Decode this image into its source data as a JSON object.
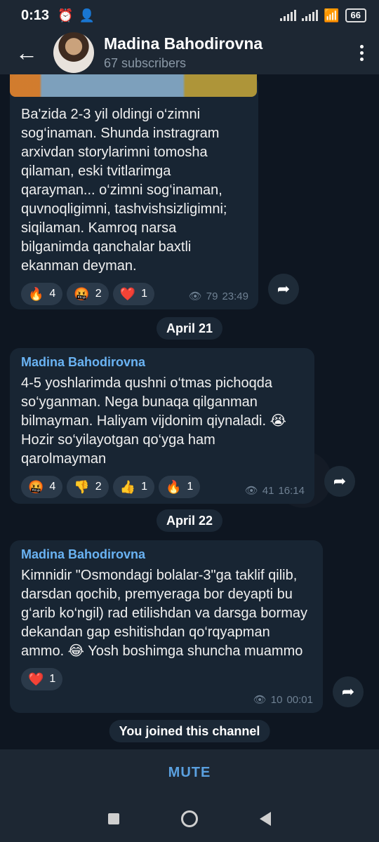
{
  "statusbar": {
    "time": "0:13",
    "battery": "66"
  },
  "header": {
    "title": "Madina Bahodirovna",
    "subtitle": "67 subscribers"
  },
  "messages": [
    {
      "text": "Ba'zida 2-3 yil oldingi o‘zimni sog‘inaman. Shunda instragram arxivdan storylarimni tomosha qilaman, eski tvitlarimga qarayman... o‘zimni sog‘inaman, quvnoqligimni, tashvishsizligimni; siqilaman. Kamroq narsa bilganimda qanchalar baxtli ekanman deyman.",
      "reactions": [
        {
          "emoji": "🔥",
          "icon": "fire-icon",
          "count": "4"
        },
        {
          "emoji": "🤬",
          "icon": "angry-face-icon",
          "count": "2"
        },
        {
          "emoji": "❤️",
          "icon": "heart-icon",
          "count": "1"
        }
      ],
      "views": "79",
      "time": "23:49"
    },
    {
      "date": "April 21",
      "sender": "Madina Bahodirovna",
      "text": "4-5 yoshlarimda qushni o‘tmas pichoqda so‘yganman. Nega bunaqa qilganman bilmayman. Haliyam vijdonim qiynaladi. 😭 Hozir so‘yilayotgan qo‘yga ham qarolmayman",
      "reactions": [
        {
          "emoji": "🤬",
          "icon": "angry-face-icon",
          "count": "4"
        },
        {
          "emoji": "👎",
          "icon": "thumbs-down-icon",
          "count": "2"
        },
        {
          "emoji": "👍",
          "icon": "thumbs-up-icon",
          "count": "1"
        },
        {
          "emoji": "🔥",
          "icon": "fire-icon",
          "count": "1"
        }
      ],
      "views": "41",
      "time": "16:14"
    },
    {
      "date": "April 22",
      "sender": "Madina Bahodirovna",
      "text": "Kimnidir \"Osmondagi bolalar-3\"ga taklif qilib, darsdan qochib, premyeraga bor deyapti bu g‘arib ko‘ngil) rad etilishdan va darsga bormay dekandan gap eshitishdan qo‘rqyapman ammo. 😂 Yosh boshimga shuncha muammo",
      "reactions": [
        {
          "emoji": "❤️",
          "icon": "heart-icon",
          "count": "1"
        }
      ],
      "views": "10",
      "time": "00:01"
    }
  ],
  "service": {
    "joined": "You joined this channel"
  },
  "footer": {
    "mute_label": "MUTE"
  }
}
